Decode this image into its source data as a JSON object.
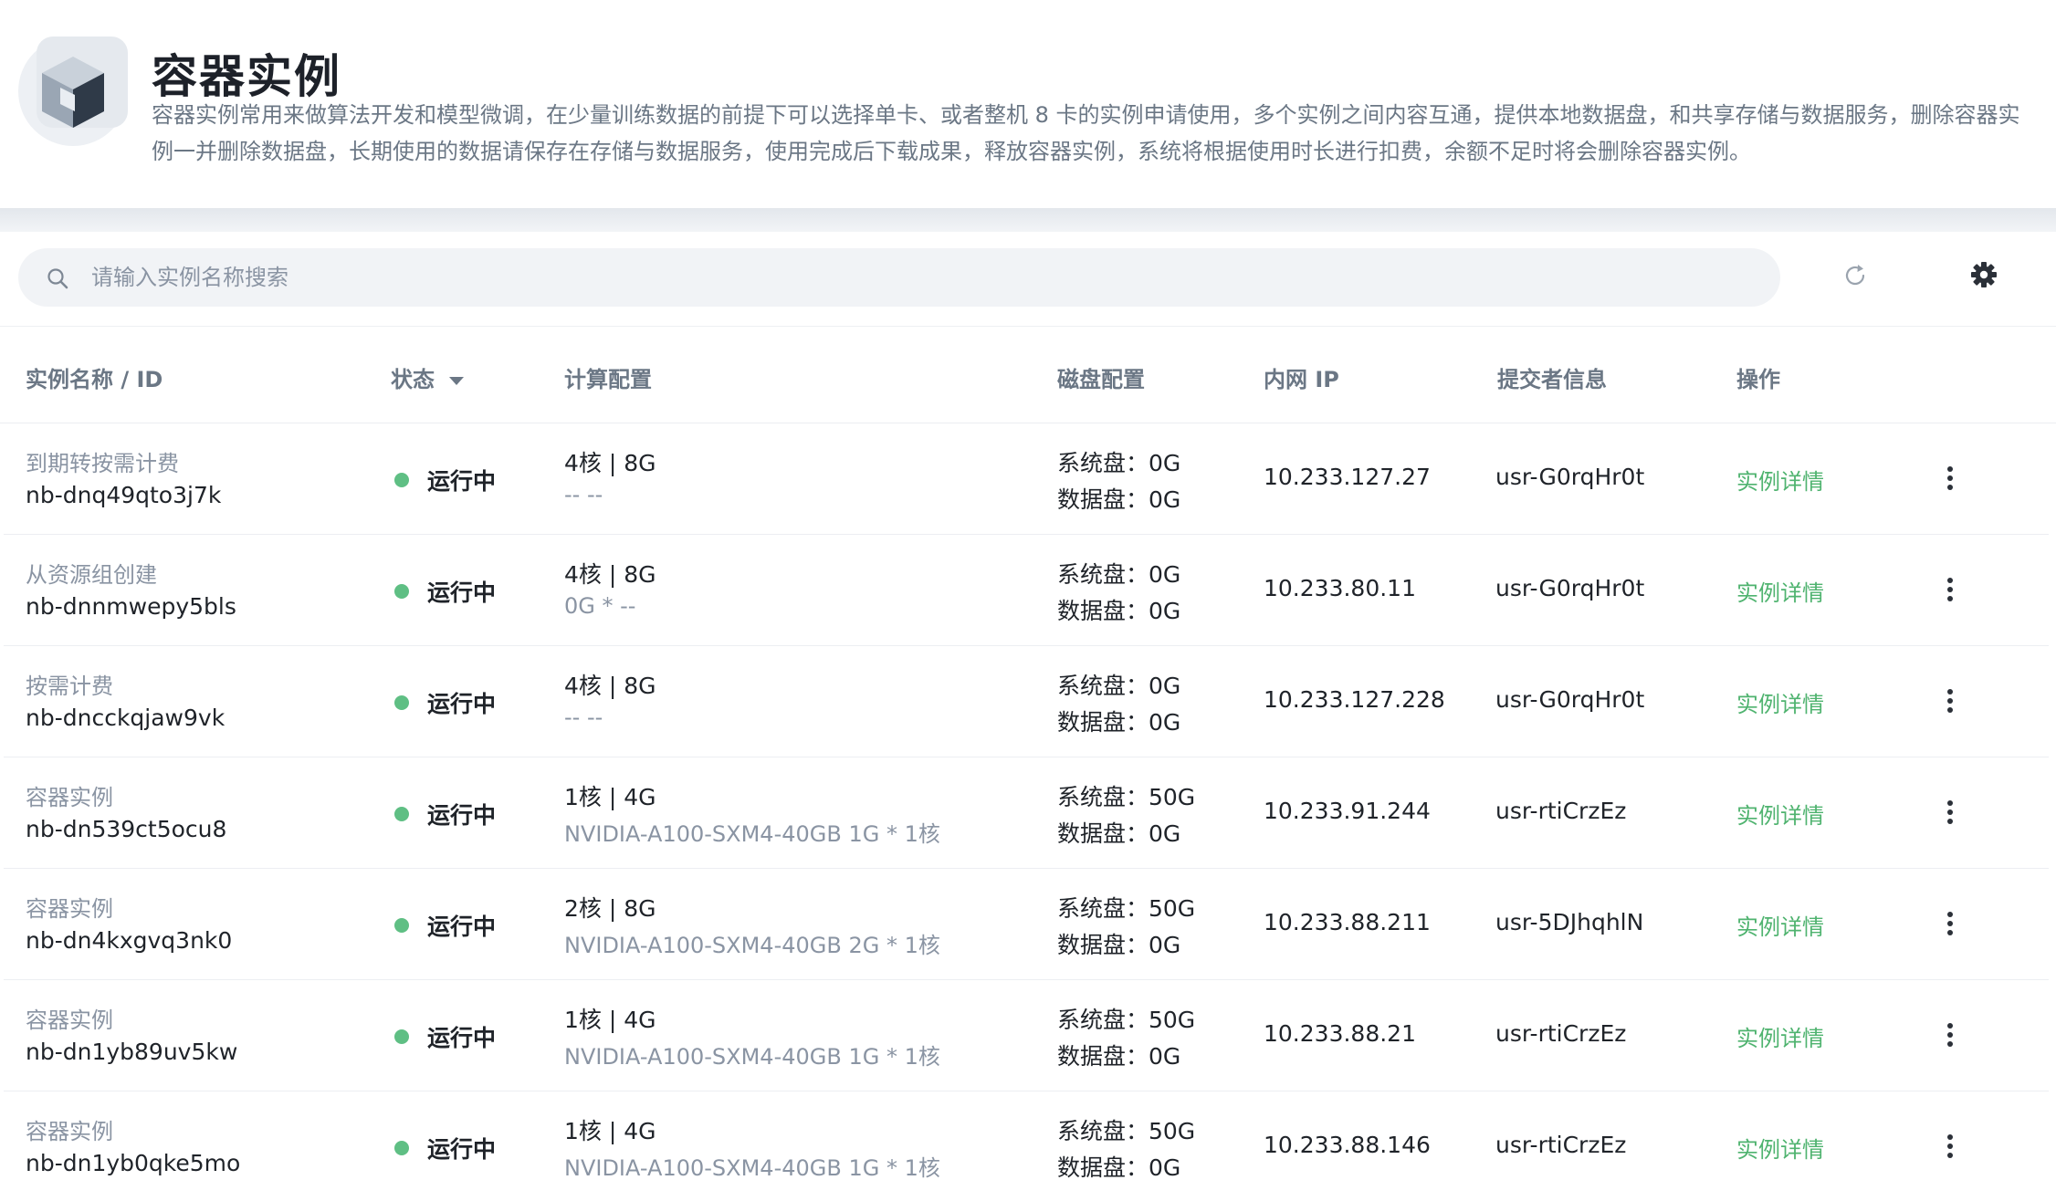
{
  "header": {
    "title": "容器实例",
    "description": "容器实例常用来做算法开发和模型微调，在少量训练数据的前提下可以选择单卡、或者整机 8 卡的实例申请使用，多个实例之间内容互通，提供本地数据盘，和共享存储与数据服务，删除容器实例一并删除数据盘，长期使用的数据请保存在存储与数据服务，使用完成后下载成果，释放容器实例，系统将根据使用时长进行扣费，余额不足时将会删除容器实例。",
    "logo_icon": "container-cube-icon"
  },
  "toolbar": {
    "search_placeholder": "请输入实例名称搜索",
    "search_value": "",
    "search_icon": "search-icon",
    "refresh_icon": "refresh-icon",
    "settings_icon": "gear-icon"
  },
  "table": {
    "columns": {
      "name": "实例名称 / ID",
      "status": "状态",
      "compute": "计算配置",
      "disk": "磁盘配置",
      "ip": "内网 IP",
      "submitter": "提交者信息",
      "actions": "操作"
    },
    "rows": [
      {
        "name": "到期转按需计费",
        "id": "nb-dnq49qto3j7k",
        "status": "运行中",
        "cpu": "4核 | 8G",
        "gpu": "-- --",
        "sys_disk": "系统盘：0G",
        "data_disk": "数据盘：0G",
        "ip": "10.233.127.27",
        "submitter": "usr-G0rqHr0t",
        "action": "实例详情"
      },
      {
        "name": "从资源组创建",
        "id": "nb-dnnmwepy5bls",
        "status": "运行中",
        "cpu": "4核 | 8G",
        "gpu": "0G * --",
        "sys_disk": "系统盘：0G",
        "data_disk": "数据盘：0G",
        "ip": "10.233.80.11",
        "submitter": "usr-G0rqHr0t",
        "action": "实例详情"
      },
      {
        "name": "按需计费",
        "id": "nb-dncckqjaw9vk",
        "status": "运行中",
        "cpu": "4核 | 8G",
        "gpu": "-- --",
        "sys_disk": "系统盘：0G",
        "data_disk": "数据盘：0G",
        "ip": "10.233.127.228",
        "submitter": "usr-G0rqHr0t",
        "action": "实例详情"
      },
      {
        "name": "容器实例",
        "id": "nb-dn539ct5ocu8",
        "status": "运行中",
        "cpu": "1核 | 4G",
        "gpu": "NVIDIA-A100-SXM4-40GB 1G * 1核",
        "sys_disk": "系统盘：50G",
        "data_disk": "数据盘：0G",
        "ip": "10.233.91.244",
        "submitter": "usr-rtiCrzEz",
        "action": "实例详情"
      },
      {
        "name": "容器实例",
        "id": "nb-dn4kxgvq3nk0",
        "status": "运行中",
        "cpu": "2核 | 8G",
        "gpu": "NVIDIA-A100-SXM4-40GB 2G * 1核",
        "sys_disk": "系统盘：50G",
        "data_disk": "数据盘：0G",
        "ip": "10.233.88.211",
        "submitter": "usr-5DJhqhlN",
        "action": "实例详情"
      },
      {
        "name": "容器实例",
        "id": "nb-dn1yb89uv5kw",
        "status": "运行中",
        "cpu": "1核 | 4G",
        "gpu": "NVIDIA-A100-SXM4-40GB 1G * 1核",
        "sys_disk": "系统盘：50G",
        "data_disk": "数据盘：0G",
        "ip": "10.233.88.21",
        "submitter": "usr-rtiCrzEz",
        "action": "实例详情"
      },
      {
        "name": "容器实例",
        "id": "nb-dn1yb0qke5mo",
        "status": "运行中",
        "cpu": "1核 | 4G",
        "gpu": "NVIDIA-A100-SXM4-40GB 1G * 1核",
        "sys_disk": "系统盘：50G",
        "data_disk": "数据盘：0G",
        "ip": "10.233.88.146",
        "submitter": "usr-rtiCrzEz",
        "action": "实例详情"
      }
    ]
  },
  "colors": {
    "status_running": "#5fbf84",
    "link": "#4fb36f",
    "muted_text": "#8a94a3"
  }
}
